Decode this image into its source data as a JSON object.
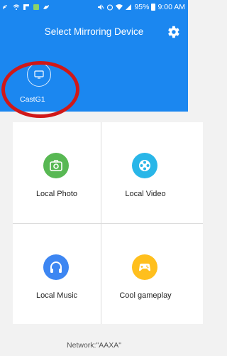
{
  "status_bar": {
    "battery": "95%",
    "time": "9:00 AM"
  },
  "header": {
    "title": "Select Mirroring Device",
    "settings_icon": "gear-icon"
  },
  "devices": [
    {
      "name": "CastG1",
      "icon": "screen-icon"
    }
  ],
  "annotation": {
    "color": "#d01818"
  },
  "menu": [
    {
      "label": "Local Photo",
      "icon": "camera-icon",
      "color": "#58b853"
    },
    {
      "label": "Local Video",
      "icon": "film-reel-icon",
      "color": "#29b6e8"
    },
    {
      "label": "Local Music",
      "icon": "headphones-icon",
      "color": "#3d86f2"
    },
    {
      "label": "Cool gameplay",
      "icon": "gamepad-icon",
      "color": "#ffbf1d"
    }
  ],
  "footer": {
    "network": "Network:\"AAXA\""
  },
  "colors": {
    "primary": "#1b87f0",
    "background": "#f2f2f2"
  }
}
